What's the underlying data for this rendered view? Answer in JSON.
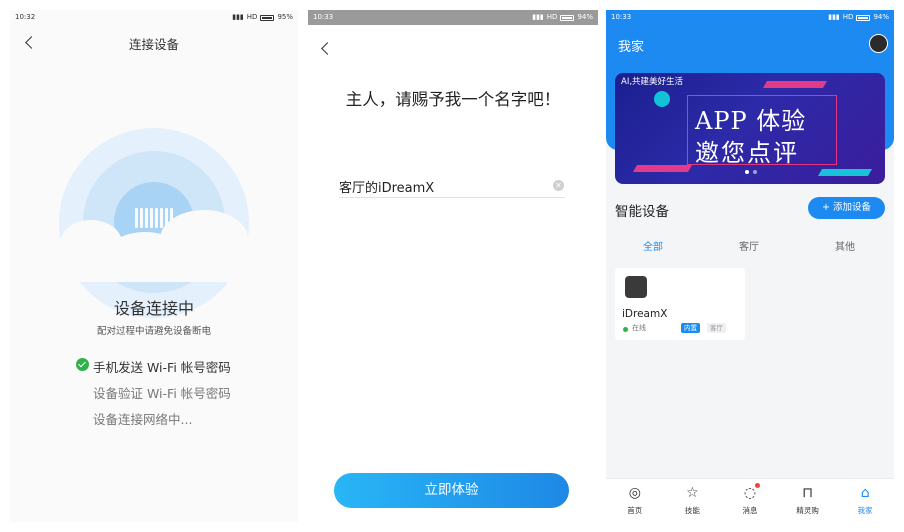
{
  "screen1": {
    "status": {
      "time": "10:32",
      "network": "HD",
      "battery": "95%"
    },
    "title": "连接设备",
    "heading": "设备连接中",
    "subtitle": "配对过程中请避免设备断电",
    "steps": [
      {
        "label": "手机发送 Wi-Fi 帐号密码",
        "done": true
      },
      {
        "label": "设备验证 Wi-Fi 帐号密码",
        "done": false
      },
      {
        "label": "设备连接网络中...",
        "done": false
      }
    ]
  },
  "screen2": {
    "status": {
      "time": "10:33",
      "network": "HD",
      "battery": "94%"
    },
    "heading": "主人，请赐予我一个名字吧！",
    "name_value": "客厅的iDreamX",
    "cta": "立即体验"
  },
  "screen3": {
    "status": {
      "time": "10:33",
      "network": "HD",
      "battery": "94%"
    },
    "title": "我家",
    "banner": {
      "tag": "AI,共建美好生活",
      "line1": "APP 体验",
      "line2": "邀您点评"
    },
    "section_title": "智能设备",
    "add_button": "+ 添加设备",
    "tabs": [
      "全部",
      "客厅",
      "其他"
    ],
    "device": {
      "name": "iDreamX",
      "status": "在线",
      "tag_builtin": "内置",
      "tag_room": "客厅"
    },
    "nav": [
      {
        "label": "首页",
        "icon": "planet-icon"
      },
      {
        "label": "技能",
        "icon": "star-icon"
      },
      {
        "label": "消息",
        "icon": "chat-icon"
      },
      {
        "label": "精灵购",
        "icon": "bag-icon"
      },
      {
        "label": "我家",
        "icon": "home-icon"
      }
    ]
  },
  "colors": {
    "accent": "#1c8af0",
    "success": "#2fb24c",
    "cta_start": "#29b6f6",
    "cta_end": "#1e88e5"
  }
}
